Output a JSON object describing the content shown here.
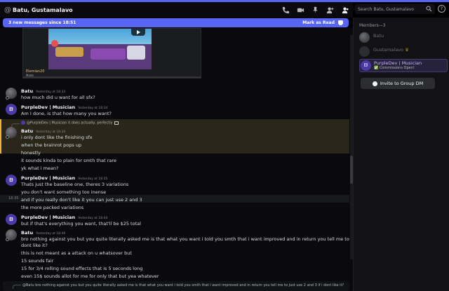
{
  "header": {
    "channel_title": "Batu, Gustamalavo",
    "search_placeholder": "Search Batu, Gustamalavo",
    "help_label": "?"
  },
  "new_messages_bar": {
    "text": "3 new messages since 18:51",
    "mark_as_read": "Mark as Read"
  },
  "video_embed": {
    "caption": "Elemian20",
    "subcaption": "Made"
  },
  "messages": [
    {
      "author": "Batu",
      "timestamp": "Yesterday at 18:33",
      "lines": [
        "how much did u want for all sfx?"
      ]
    },
    {
      "author": "PurpleDev | Musician",
      "timestamp": "Yesterday at 18:34",
      "lines": [
        "Am I done, is that how many you want?"
      ]
    },
    {
      "reply_to": "@PurpleDev | Musician it does actually, perfectly",
      "author": "Batu",
      "timestamp": "Yesterday at 18:34",
      "lines": [
        "i only dont like the finishing sfx",
        "when the brainrot pops up",
        "honestly",
        "it sounds kinda to plain for smth that rare",
        "yk what i mean?"
      ]
    },
    {
      "author": "PurpleDev | Musician",
      "timestamp": "Yesterday at 18:35",
      "lines": [
        "Thats just the baseline one, theres 3 variations",
        "you don't want something too inense",
        "and if you really don't like it you can just use 2 and 3",
        "the more packed variations"
      ],
      "hover_timestamp": "18:35"
    },
    {
      "author": "PurpleDev | Musician",
      "timestamp": "Yesterday at 18:44",
      "lines": [
        "but if that's everything you want, that'll be $25 total"
      ]
    },
    {
      "author": "Batu",
      "timestamp": "Yesterday at 18:49",
      "lines": [
        "bro nothing against you but you quite literally asked me is that what you want i told you smth that i want improved and in return you tell me to just use 2 and 3 if i",
        "dont like it?",
        "this is not meant as a attack on u whatsover but",
        "15 sounds fair",
        "15 for 3/4 rolling sound effects that is 5 seconds long",
        "even 15$ sounds allot for me for only that but yea whatever"
      ]
    }
  ],
  "reply_bar": {
    "text": "@Batu bro nothing against you but you quite literally asked me is that what you want i told you smth that i want improved and in return you tell me to just use 2 and 3 if i dont like it?"
  },
  "members_panel": {
    "heading": "Members—3",
    "members": [
      {
        "name": "Batu",
        "status": "",
        "color": "#6d6f78"
      },
      {
        "name": "Gustamalavo",
        "status": "",
        "color": "#6d6f78",
        "badge": "♛"
      },
      {
        "name": "PurpleDev | Musician",
        "status": "✅ Commissions Open!",
        "color": "#c9b6ff"
      }
    ],
    "invite_button": "Invite to Group DM"
  },
  "colors": {
    "accent": "#5865f2",
    "highlight_bar": "#f0b232",
    "purple_avatar": "#4b3aa6"
  }
}
